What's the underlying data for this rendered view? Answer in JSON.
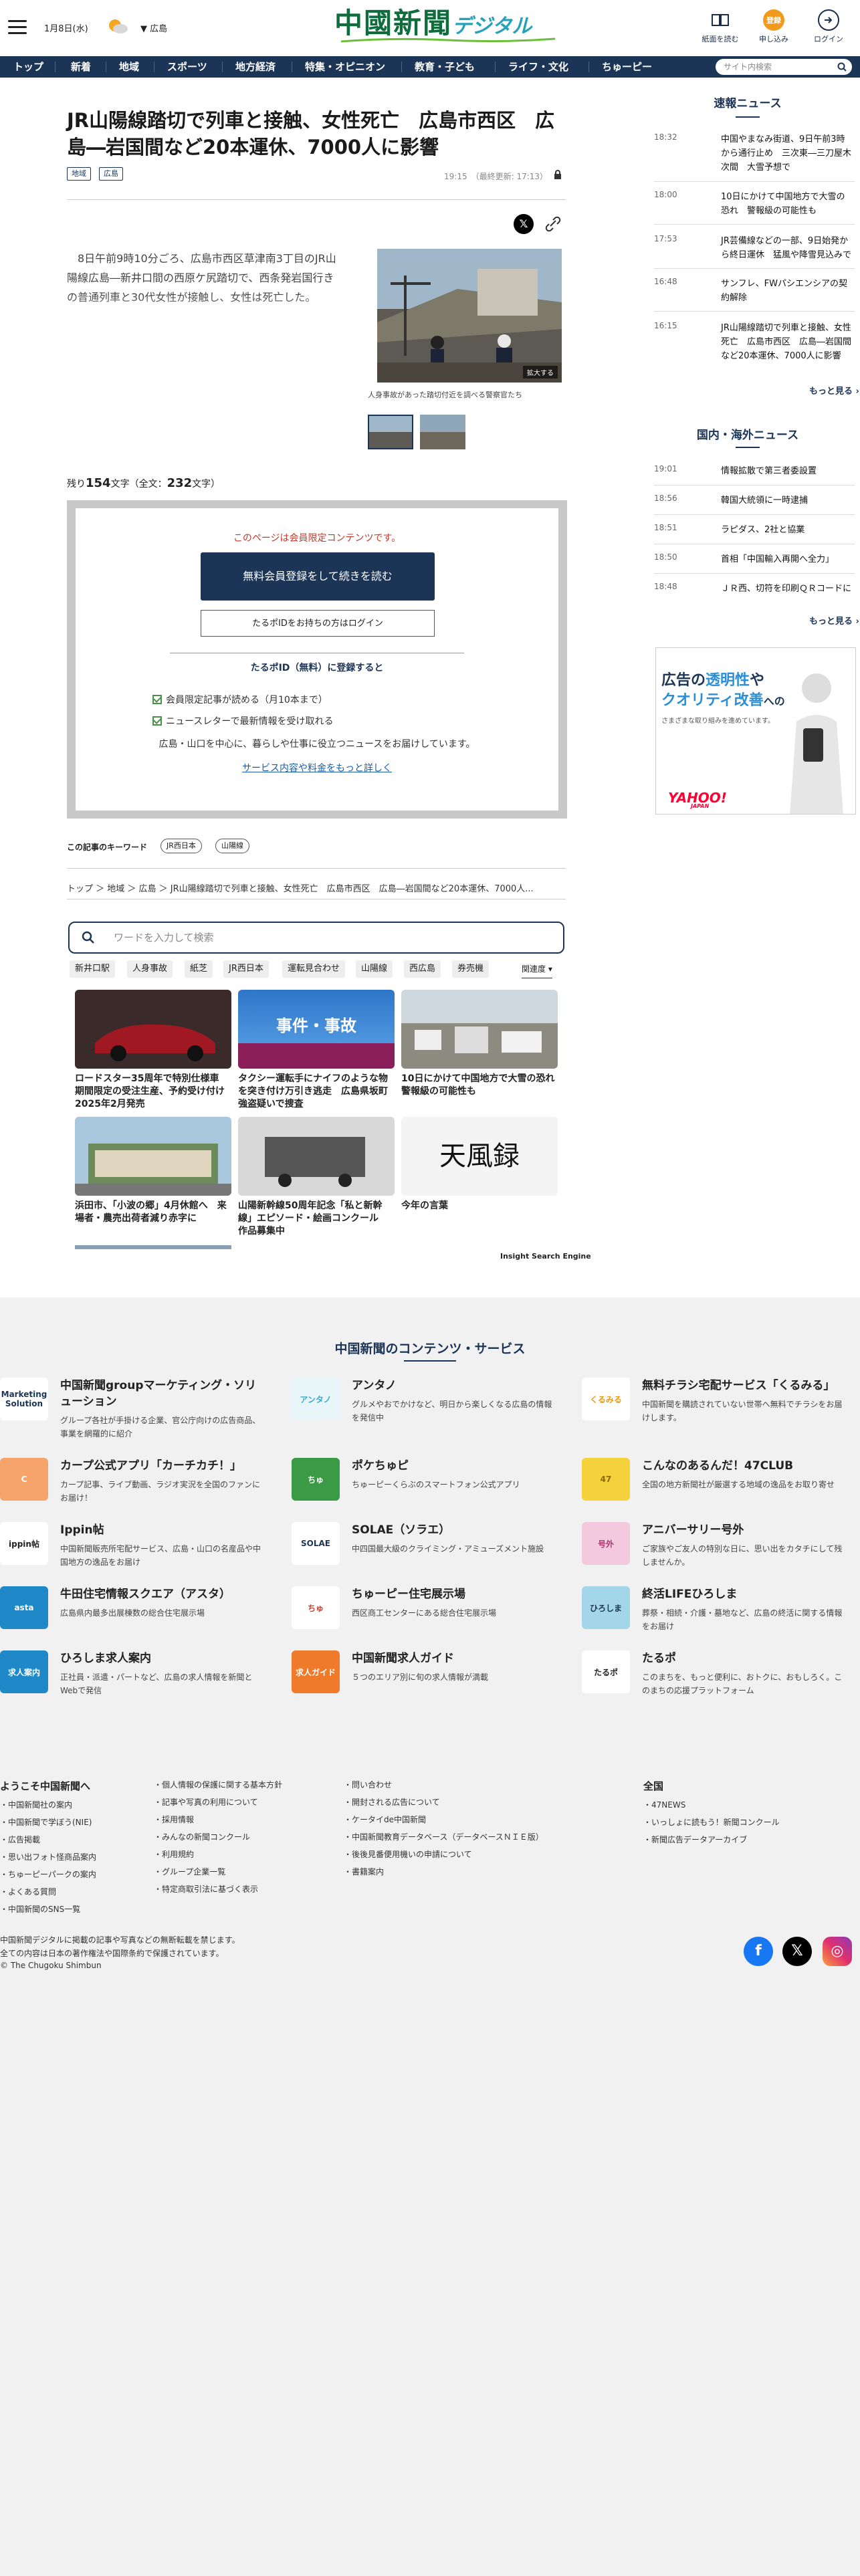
{
  "header": {
    "date": "1月8日(水)",
    "region": "広島",
    "logo_kanji": "中國新聞",
    "logo_digital": "デジタル",
    "btn_paper": "紙面を読む",
    "btn_register": "申し込み",
    "btn_login": "ログイン",
    "btn_register_badge": "登録"
  },
  "nav": {
    "items": [
      "トップ",
      "新着",
      "地域",
      "スポーツ",
      "地方経済",
      "特集・オピニオン",
      "教育・子ども",
      "ライフ・文化",
      "ちゅーピー"
    ],
    "search_placeholder": "サイト内検索"
  },
  "article": {
    "title": "JR山陽線踏切で列車と接触、女性死亡　広島市西区　広島―岩国間など20本運休、7000人に影響",
    "tags": [
      "地域",
      "広島"
    ],
    "time": "19:15　（最終更新: 17:13）",
    "body": "　8日午前9時10分ごろ、広島市西区草津南3丁目のJR山陽線広島―新井口間の西原ケ尻踏切で、西条発岩国行きの普通列車と30代女性が接触し、女性は死亡した。",
    "photo_caption": "人身事故があった踏切付近を調べる警察官たち",
    "zoom_label": "拡大する",
    "remain_prefix": "残り",
    "remain_count": "154",
    "remain_mid": "文字（全文：",
    "total_count": "232",
    "remain_suffix": "文字）"
  },
  "paywall": {
    "notice": "このページは会員限定コンテンツです。",
    "register_btn": "無料会員登録をして続きを読む",
    "login_btn": "たるポIDをお持ちの方はログイン",
    "heading": "たるポID（無料）に登録すると",
    "benefits": [
      "会員限定記事が読める（月10本まで）",
      "ニュースレターで最新情報を受け取れる"
    ],
    "desc": "広島・山口を中心に、暮らしや仕事に役立つニュースをお届けしています。",
    "link": "サービス内容や料金をもっと詳しく"
  },
  "keywords": {
    "label": "この記事のキーワード",
    "items": [
      "JR西日本",
      "山陽線"
    ]
  },
  "breadcrumb": "トップ ＞ 地域 ＞ 広島 ＞ JR山陽線踏切で列車と接触、女性死亡　広島市西区　広島―岩国間など20本運休、7000人...",
  "search": {
    "placeholder": "ワードを入力して検索",
    "pills": [
      "新井口駅",
      "人身事故",
      "紙芝",
      "JR西日本",
      "運転見合わせ",
      "山陽線",
      "西広島",
      "券売機"
    ],
    "related_label": "関連度"
  },
  "related": [
    {
      "title": "ロードスター35周年で特別仕様車　期間限定の受注生産、予約受け付け　2025年2月発売"
    },
    {
      "title": "タクシー運転手にナイフのような物を突き付け万引き逃走　広島県坂町　強盗疑いで捜査",
      "badge": "事件・事故"
    },
    {
      "title": "10日にかけて中国地方で大雪の恐れ　警報級の可能性も"
    },
    {
      "title": "浜田市、「小波の郷」4月休館へ　来場者・農売出荷者減り赤字に"
    },
    {
      "title": "山陽新幹線50周年記念「私と新幹線」エピソード・絵画コンクール　作品募集中"
    },
    {
      "title": "今年の言葉",
      "calligraphy": "天風録"
    }
  ],
  "insight": "Insight Search Engine",
  "sidebar": {
    "breaking_title": "速報ニュース",
    "breaking": [
      {
        "time": "18:32",
        "text": "中国やまなみ街道、9日午前3時から通行止め　三次東―三刀屋木次間　大雪予想で"
      },
      {
        "time": "18:00",
        "text": "10日にかけて中国地方で大雪の恐れ　警報級の可能性も"
      },
      {
        "time": "17:53",
        "text": "JR芸備線などの一部、9日始発から終日運休　猛風や降雪見込みで"
      },
      {
        "time": "16:48",
        "text": "サンフレ、FWパシエンシアの契約解除"
      },
      {
        "time": "16:15",
        "text": "JR山陽線踏切で列車と接触、女性死亡　広島市西区　広島―岩国間など20本運休、7000人に影響"
      }
    ],
    "more": "もっと見る ›",
    "world_title": "国内・海外ニュース",
    "world": [
      {
        "time": "19:01",
        "text": "情報拡散で第三者委設置"
      },
      {
        "time": "18:56",
        "text": "韓国大統領に一時逮捕"
      },
      {
        "time": "18:51",
        "text": "ラピダス、2社と協業"
      },
      {
        "time": "18:50",
        "text": "首相「中国輸入再開へ全力」"
      },
      {
        "time": "18:48",
        "text": "ＪＲ西、切符を印刷ＱＲコードに"
      }
    ],
    "ad_line1a": "広告の",
    "ad_line1b": "透明性",
    "ad_line1c": "や",
    "ad_line2a": "クオリティ改善",
    "ad_line2b": "への",
    "ad_line3": "さまざまな取り組みを進めています。",
    "ad_brand": "YAHOO!",
    "ad_brand_sub": "JAPAN"
  },
  "services": {
    "title": "中国新聞のコンテンツ・サービス",
    "items": [
      {
        "name": "中国新聞groupマーケティング・ソリューション",
        "desc": "グループ各社が手掛ける企業、官公庁向けの広告商品、事業を網羅的に紹介",
        "logo": "Marketing Solution",
        "color": "#ffffff",
        "fg": "#1c3557"
      },
      {
        "name": "アンタノ",
        "desc": "グルメやおでかけなど、明日から楽しくなる広島の情報を発信中",
        "logo": "アンタノ",
        "color": "#e8f6f9",
        "fg": "#3aaac8"
      },
      {
        "name": "無料チラシ宅配サービス「くるみる」",
        "desc": "中国新聞を購読されていない世帯へ無料でチラシをお届けします。",
        "logo": "くるみる",
        "color": "#ffffff",
        "fg": "#e89a12"
      },
      {
        "name": "カープ公式アプリ「カーチカチ！」",
        "desc": "カープ記事、ライブ動画、ラジオ実況を全国のファンにお届け！",
        "logo": "C",
        "color": "#f6a46b",
        "fg": "#ffffff"
      },
      {
        "name": "ポケちゅピ",
        "desc": "ちゅーピーくらぶのスマートフォン公式アプリ",
        "logo": "ちゅ",
        "color": "#3a9a46",
        "fg": "#ffffff"
      },
      {
        "name": "こんなのあるんだ！47CLUB",
        "desc": "全国の地方新聞社が厳選する地域の逸品をお取り寄せ",
        "logo": "47",
        "color": "#f3d23b",
        "fg": "#8a6b00"
      },
      {
        "name": "Ippin帖",
        "desc": "中国新聞販売所宅配サービス、広島・山口の名産品や中国地方の逸品をお届け",
        "logo": "ippin帖",
        "color": "#ffffff",
        "fg": "#222222"
      },
      {
        "name": "SOLAE（ソラエ）",
        "desc": "中四国最大級のクライミング・アミューズメント施設",
        "logo": "SOLAE",
        "color": "#ffffff",
        "fg": "#1c3557"
      },
      {
        "name": "アニバーサリー号外",
        "desc": "ご家族やご友人の特別な日に、思い出をカタチにして残しませんか。",
        "logo": "号外",
        "color": "#f3c9de",
        "fg": "#b03670"
      },
      {
        "name": "牛田住宅情報スクエア（アスタ）",
        "desc": "広島県内最多出展棟数の総合住宅展示場",
        "logo": "asta",
        "color": "#1e88c8",
        "fg": "#ffffff"
      },
      {
        "name": "ちゅーピー住宅展示場",
        "desc": "西区商工センターにある総合住宅展示場",
        "logo": "ちゅ",
        "color": "#ffffff",
        "fg": "#d03a2a"
      },
      {
        "name": "終活LIFEひろしま",
        "desc": "葬祭・相続・介護・墓地など、広島の終活に関する情報をお届け",
        "logo": "ひろしま",
        "color": "#a3d6e8",
        "fg": "#1c3557"
      },
      {
        "name": "ひろしま求人案内",
        "desc": "正社員・派遣・パートなど、広島の求人情報を新聞とWebで発信",
        "logo": "求人案内",
        "color": "#1e88c8",
        "fg": "#ffffff"
      },
      {
        "name": "中国新聞求人ガイド",
        "desc": "５つのエリア別に旬の求人情報が満載",
        "logo": "求人ガイド",
        "color": "#ef7a2a",
        "fg": "#ffffff"
      },
      {
        "name": "たるポ",
        "desc": "このまちを、もっと便利に、おトクに、おもしろく。このまちの応援プラットフォーム",
        "logo": "たるポ",
        "color": "#ffffff",
        "fg": "#222222"
      }
    ]
  },
  "footer": {
    "col1_title": "ようこそ中国新聞へ",
    "col1": [
      "中国新聞社の案内",
      "中国新聞で学ぼう(NIE)",
      "広告掲載",
      "思い出フォト怪商品案内",
      "ちゅーピーパークの案内",
      "よくある質問",
      "中国新聞のSNS一覧"
    ],
    "col2": [
      "個人情報の保護に関する基本方針",
      "記事や写真の利用について",
      "採用情報",
      "みんなの新聞コンクール",
      "利用規約",
      "グループ企業一覧",
      "特定商取引法に基づく表示"
    ],
    "col3": [
      "問い合わせ",
      "開封される広告について",
      "ケータイde中国新聞",
      "中国新聞教育データベース（データベースＮＩＥ版）",
      "後後見番便用機いの申請について",
      "書籍案内"
    ],
    "col4_title": "全国",
    "col4": [
      "47NEWS",
      "いっしょに読もう！新聞コンクール",
      "新聞広告データアーカイブ"
    ],
    "copy1": "中国新聞デジタルに掲載の記事や写真などの無断転載を禁じます。",
    "copy2": "全ての内容は日本の著作権法や国際条約で保護されています。",
    "copy3": "© The Chugoku Shimbun"
  }
}
